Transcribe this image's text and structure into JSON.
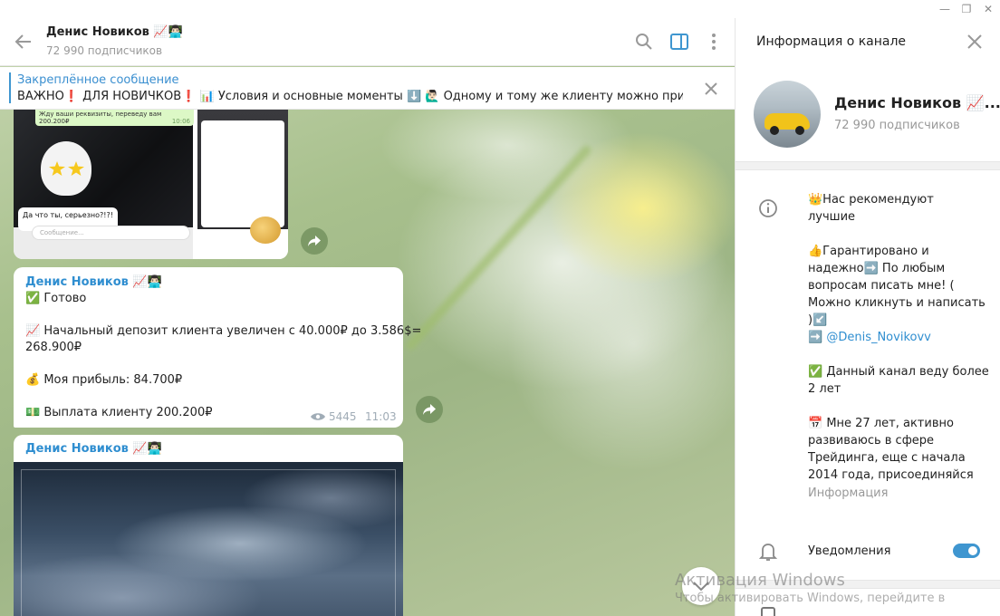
{
  "channel": {
    "title": "Денис Новиков 📈👨🏻‍💻",
    "subscribers": "72 990 подписчиков"
  },
  "pinned": {
    "title": "Закреплённое сообщение",
    "text": "ВАЖНО❗ ДЛЯ НОВИЧКОВ❗ 📊 Условия и основные моменты ⬇️ 🙋🏻‍♂️ Одному и тому же клиенту можно  приум..."
  },
  "image_message": {
    "bubble_top_text": "Жду ваши реквизиты, переведу вам 200.200₽",
    "bubble_time": "10:06",
    "bubble_reply": "Да что ты, серьезно?!?!",
    "input_placeholder": "Сообщение..."
  },
  "text_message": {
    "sender": "Денис Новиков 📈👨🏻‍💻",
    "line1": "✅ Готово",
    "line2": "📈 Начальный депозит клиента увеличен с 40.000₽ до 3.586$=",
    "line3": "268.900₽",
    "line4": "💰 Моя прибыль: 84.700₽",
    "line5": "💵 Выплата клиенту 200.200₽",
    "views": "5445",
    "time": "11:03"
  },
  "photo_message": {
    "sender": "Денис Новиков 📈👨🏻‍💻"
  },
  "panel": {
    "title": "Информация о канале",
    "name": "Денис Новиков 📈...",
    "subscribers": "72 990 подписчиков",
    "info_p1": "👑Нас рекомендуют\nлучшие",
    "info_p2": "👍Гарантировано и\nнадежно➡️ По любым\nвопросам писать мне! (\nМожно кликнуть и написать\n)↙️",
    "info_link_prefix": "➡️ ",
    "info_link": "@Denis_Novikovv",
    "info_p3": "✅ Данный канал веду более\n2 лет",
    "info_p4": "📅 Мне 27 лет, активно\nразвиваюсь в сфере\nТрейдинга, еще с начала\n2014 года, присоединяйся",
    "info_label": "Информация",
    "notifications_label": "Уведомления",
    "notifications_on": true
  },
  "watermark": {
    "line1": "Активация Windows",
    "line2": "Чтобы активировать Windows, перейдите в"
  },
  "colors": {
    "accent": "#3f96d0",
    "link": "#2f8ed0"
  }
}
